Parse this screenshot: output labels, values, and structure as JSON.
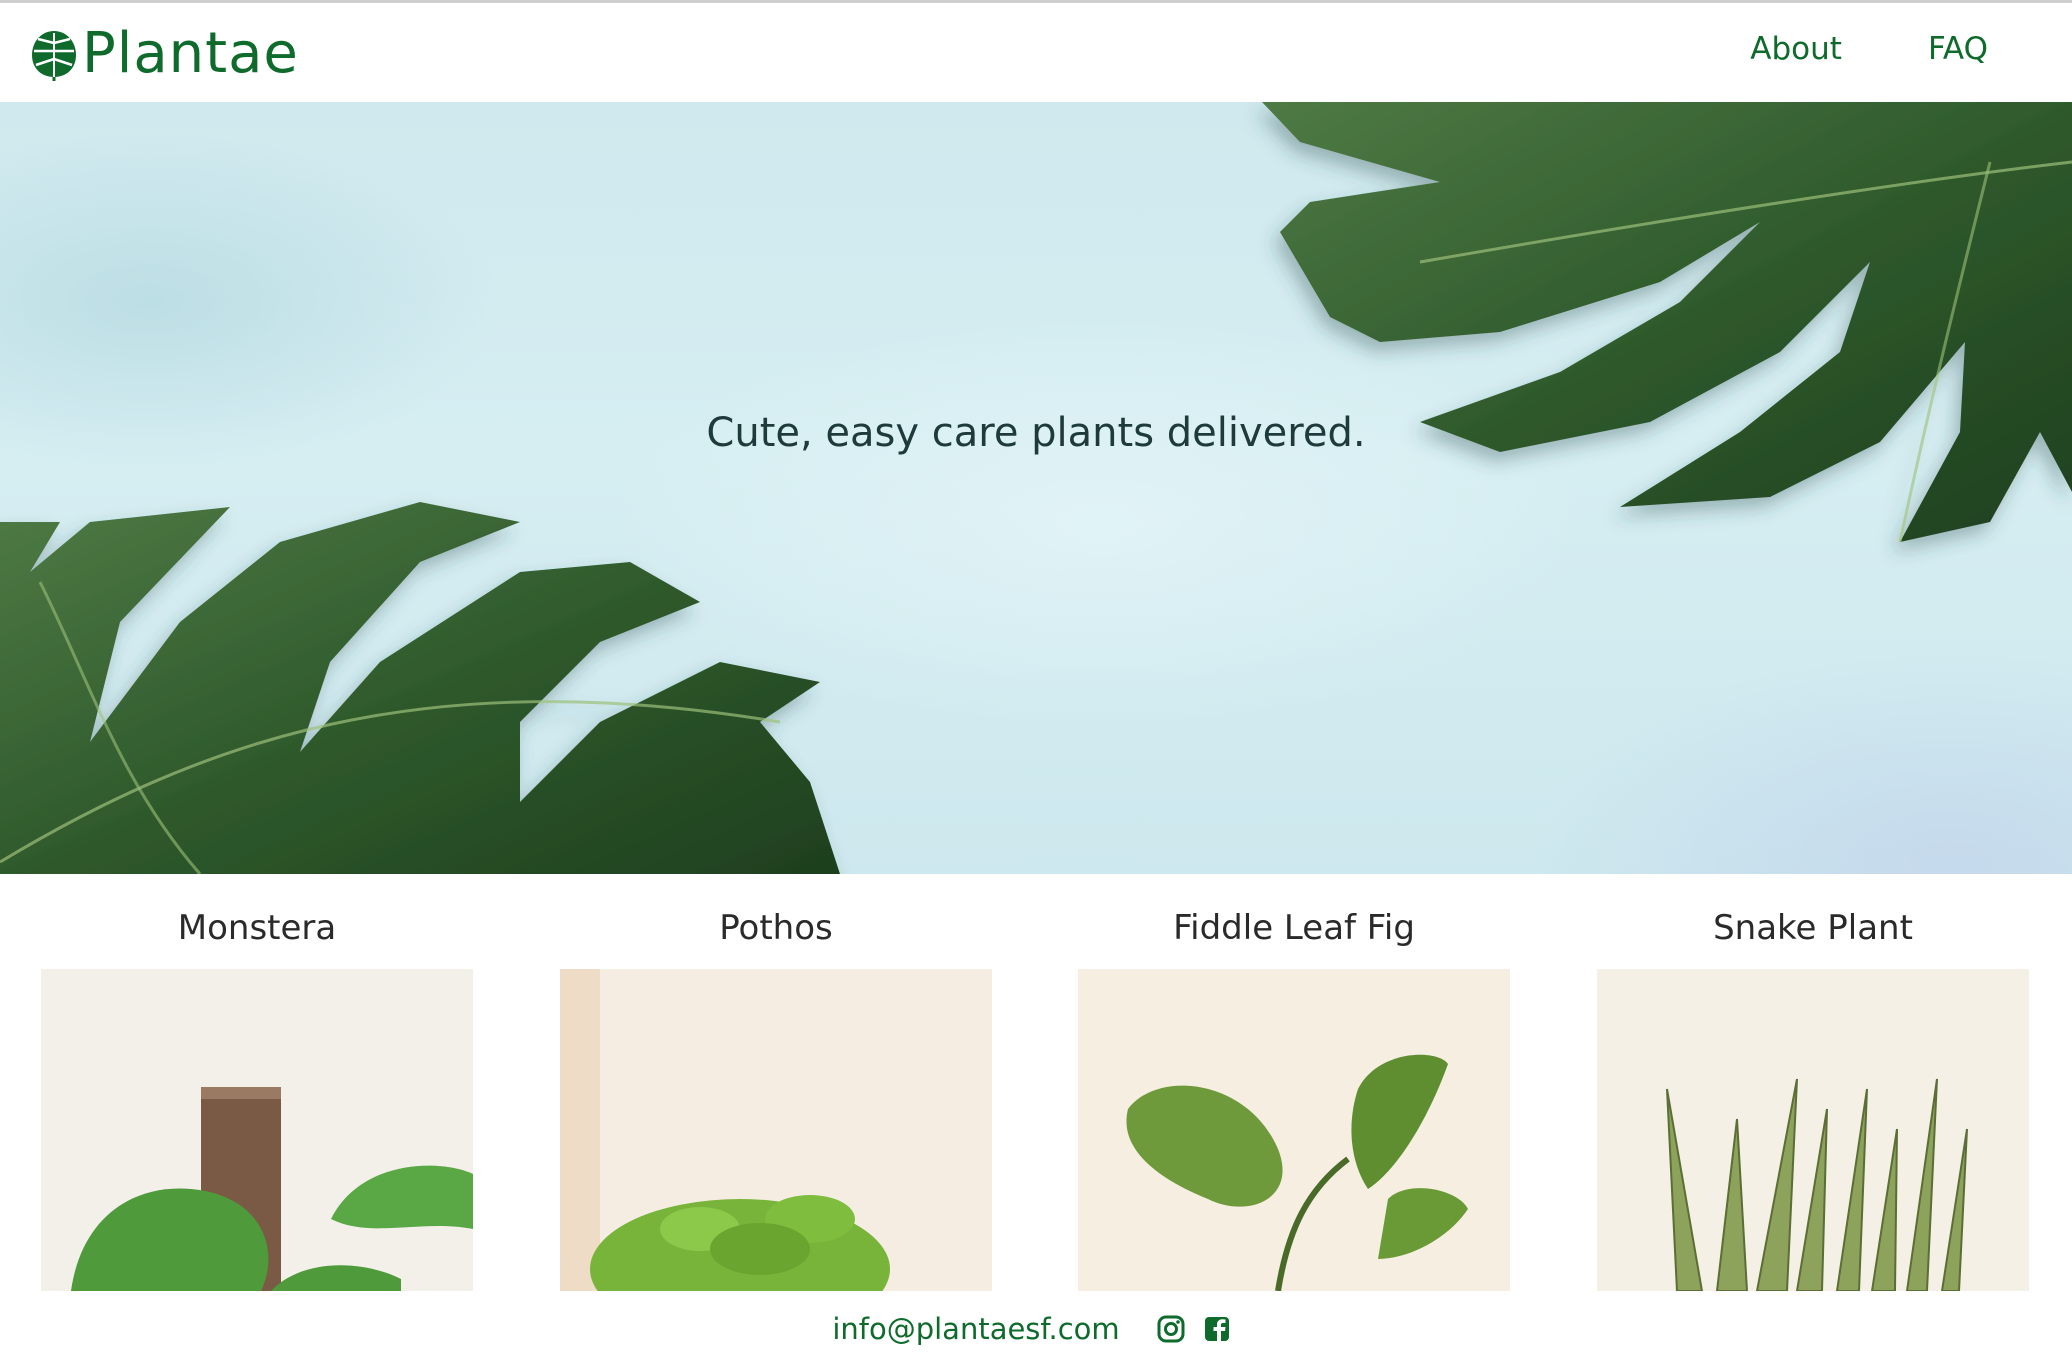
{
  "brand": {
    "name": "Plantae",
    "logo_icon": "monstera-leaf-icon",
    "color": "#0e6b2b"
  },
  "nav": {
    "items": [
      {
        "label": "About"
      },
      {
        "label": "FAQ"
      }
    ]
  },
  "hero": {
    "tagline": "Cute, easy care plants delivered.",
    "background": "#d2ecf0"
  },
  "products": [
    {
      "name": "Monstera",
      "image": "monstera-plant-photo"
    },
    {
      "name": "Pothos",
      "image": "pothos-plant-photo"
    },
    {
      "name": "Fiddle Leaf Fig",
      "image": "fiddle-leaf-fig-photo"
    },
    {
      "name": "Snake Plant",
      "image": "snake-plant-photo"
    }
  ],
  "footer": {
    "email": "info@plantaesf.com",
    "icons": [
      "instagram-icon",
      "facebook-icon"
    ]
  }
}
